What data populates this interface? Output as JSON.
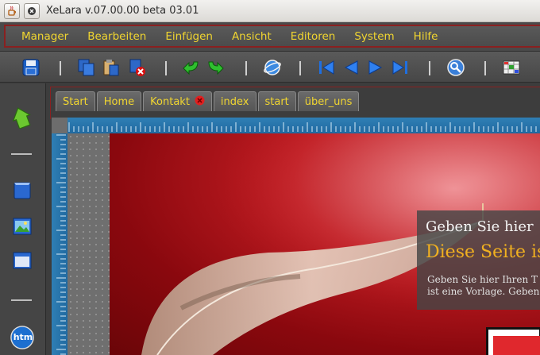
{
  "window": {
    "title": "XeLara v.07.00.00 beta 03.01"
  },
  "menu": [
    "Manager",
    "Bearbeiten",
    "Einfügen",
    "Ansicht",
    "Editoren",
    "System",
    "Hilfe"
  ],
  "tabs": [
    "Start",
    "Home",
    "Kontakt",
    "index",
    "start",
    "über_uns"
  ],
  "left_panel": {
    "htm_badge": "htm"
  },
  "page": {
    "heading": "Geben Sie hier",
    "subheading": "Diese Seite is",
    "body_line1": "Geben Sie hier Ihren T",
    "body_line2": "ist eine Vorlage. Geben"
  },
  "colors": {
    "menu_text": "#f0d530",
    "accent_border": "#8a2020",
    "ruler": "#2f7fb5",
    "hero_red": "#c01c22",
    "subheading": "#f0b020"
  },
  "icons": {
    "toolbar": [
      "save-icon",
      "copy-pages-icon",
      "paste-icon",
      "delete-icon",
      "undo-icon",
      "redo-icon",
      "publish-icon",
      "first-icon",
      "previous-icon",
      "next-icon",
      "last-icon",
      "preview-icon",
      "layout-icon"
    ],
    "left_panel": [
      "cursor-arrow-icon",
      "layer-icon",
      "image-icon",
      "window-icon",
      "htm-icon"
    ]
  }
}
